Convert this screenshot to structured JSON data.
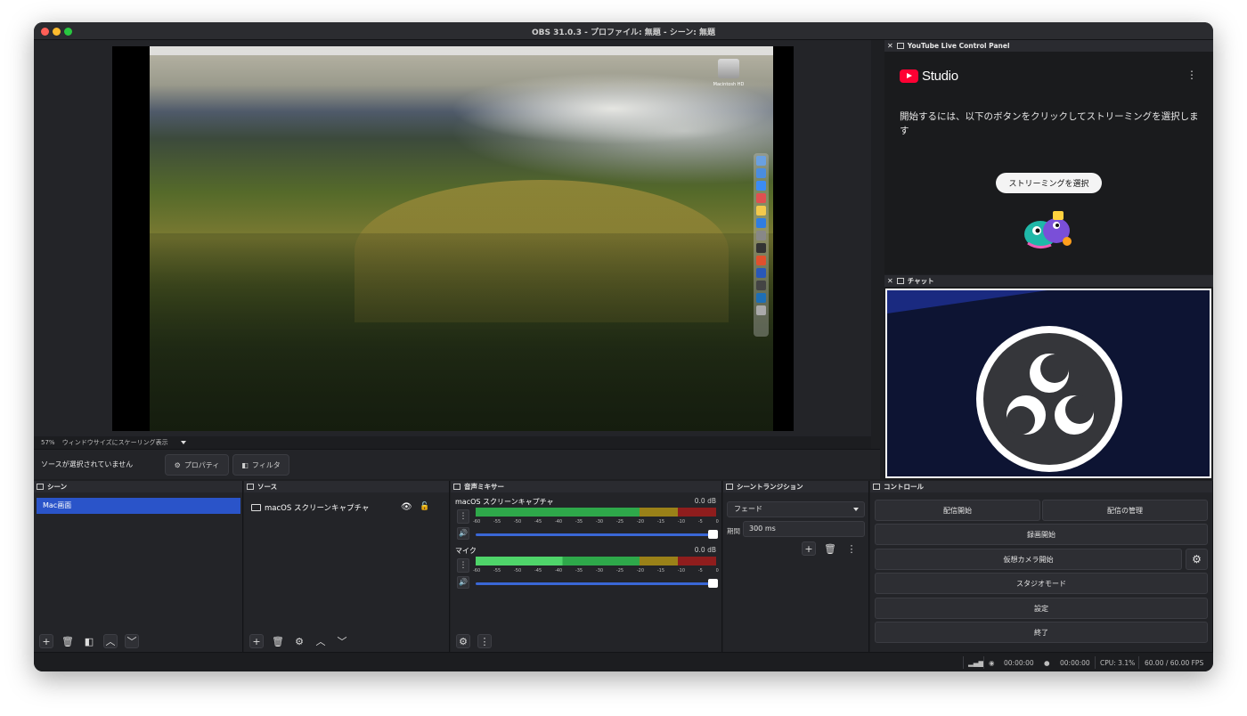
{
  "window": {
    "title": "OBS 31.0.3 - プロファイル: 無題 - シーン: 無題"
  },
  "preview": {
    "zoom": "57%",
    "scale_mode": "ウィンドウサイズにスケーリング表示",
    "desktop_drive_label": "Macintosh HD"
  },
  "source_toolbar": {
    "no_selection": "ソースが選択されていません",
    "properties": "プロパティ",
    "filters": "フィルタ"
  },
  "youtube": {
    "dock_title": "YouTube Live Control Panel",
    "studio": "Studio",
    "message": "開始するには、以下のボタンをクリックしてストリーミングを選択します",
    "button": "ストリーミングを選択"
  },
  "chat": {
    "dock_title": "チャット"
  },
  "scenes": {
    "title": "シーン",
    "items": [
      "Mac画面"
    ]
  },
  "sources": {
    "title": "ソース",
    "items": [
      "macOS スクリーンキャプチャ"
    ]
  },
  "mixer": {
    "title": "音声ミキサー",
    "ticks": [
      "-60",
      "-55",
      "-50",
      "-45",
      "-40",
      "-35",
      "-30",
      "-25",
      "-20",
      "-15",
      "-10",
      "-5",
      "0"
    ],
    "channels": [
      {
        "name": "macOS スクリーンキャプチャ",
        "db": "0.0 dB",
        "level": 0
      },
      {
        "name": "マイク",
        "db": "0.0 dB",
        "level": 0.44
      }
    ]
  },
  "transitions": {
    "title": "シーントランジション",
    "selected": "フェード",
    "duration_label": "期間",
    "duration": "300 ms"
  },
  "controls": {
    "title": "コントロール",
    "start_streaming": "配信開始",
    "manage_broadcast": "配信の管理",
    "start_recording": "録画開始",
    "start_virtual_camera": "仮想カメラ開始",
    "studio_mode": "スタジオモード",
    "settings": "設定",
    "exit": "終了"
  },
  "status": {
    "stream_time": "00:00:00",
    "record_time": "00:00:00",
    "cpu": "CPU: 3.1%",
    "fps": "60.00 / 60.00 FPS"
  }
}
